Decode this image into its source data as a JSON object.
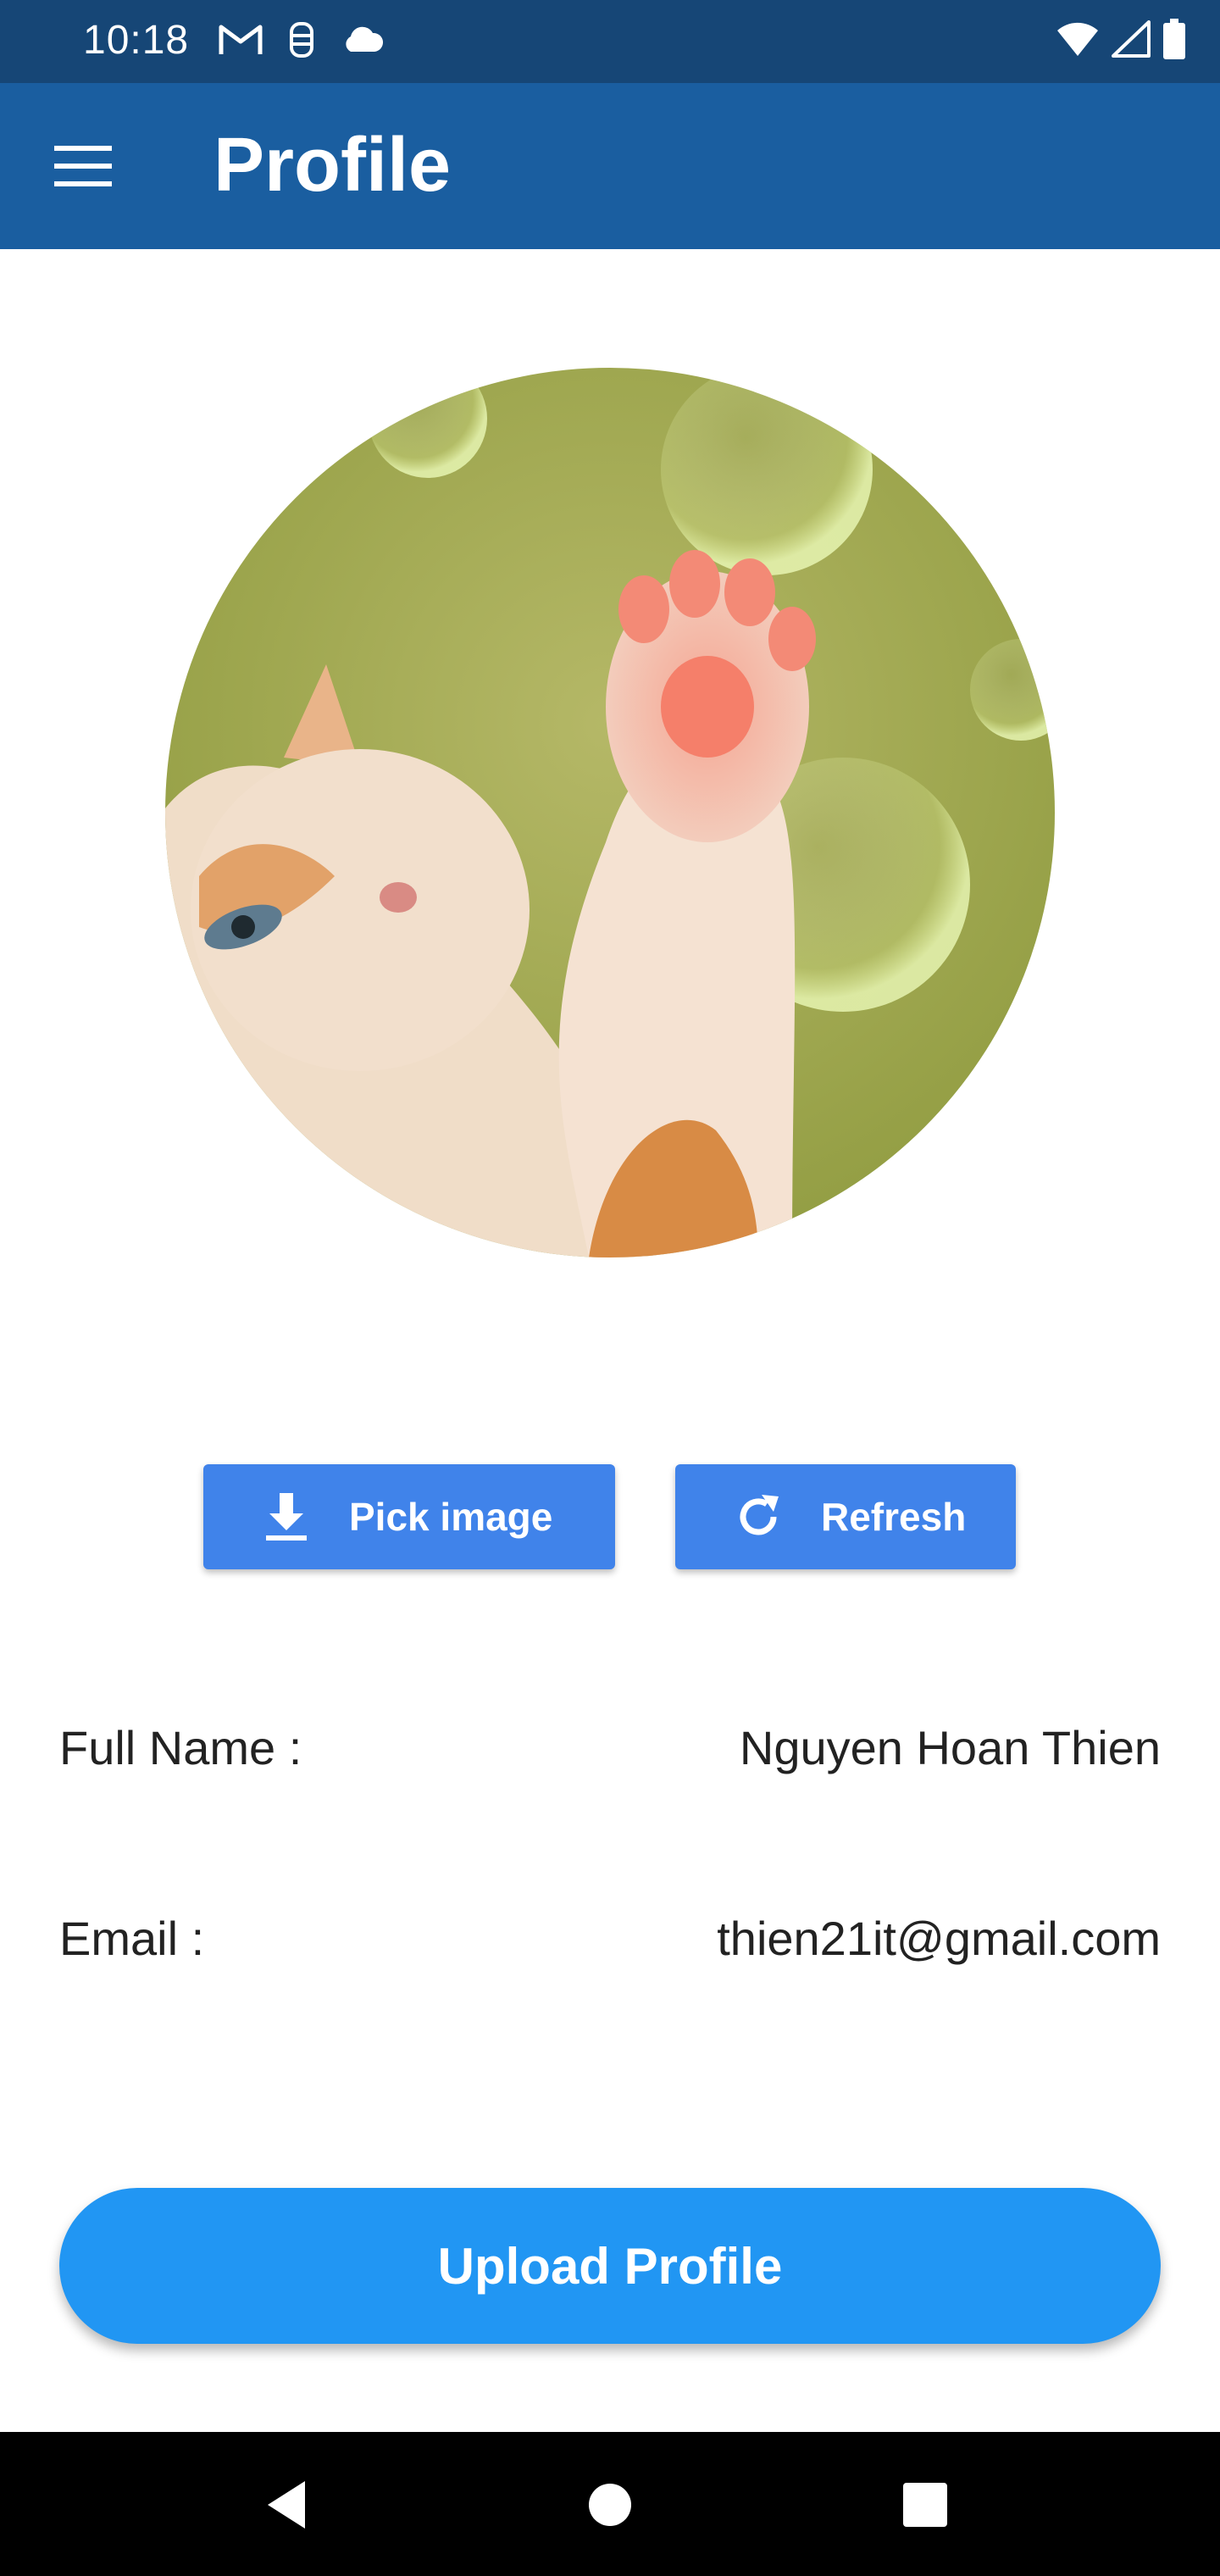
{
  "status_bar": {
    "time": "10:18",
    "left_icons": [
      "gmail-icon",
      "vpn-key-icon",
      "cloud-icon"
    ],
    "right_icons": [
      "wifi-icon",
      "signal-icon",
      "battery-icon"
    ]
  },
  "app_bar": {
    "title": "Profile",
    "menu_icon": "hamburger-menu-icon"
  },
  "avatar": {
    "description_icon": "cat-photo"
  },
  "buttons": {
    "pick_image": "Pick image",
    "refresh": "Refresh"
  },
  "profile": {
    "full_name_label": "Full Name :",
    "full_name_value": "Nguyen Hoan Thien",
    "email_label": "Email :",
    "email_value": "thien21it@gmail.com"
  },
  "upload": {
    "label": "Upload Profile"
  },
  "colors": {
    "status_bar": "#164676",
    "app_bar": "#1a5ea0",
    "action_button": "#4083ea",
    "upload_button": "#2196f3"
  }
}
